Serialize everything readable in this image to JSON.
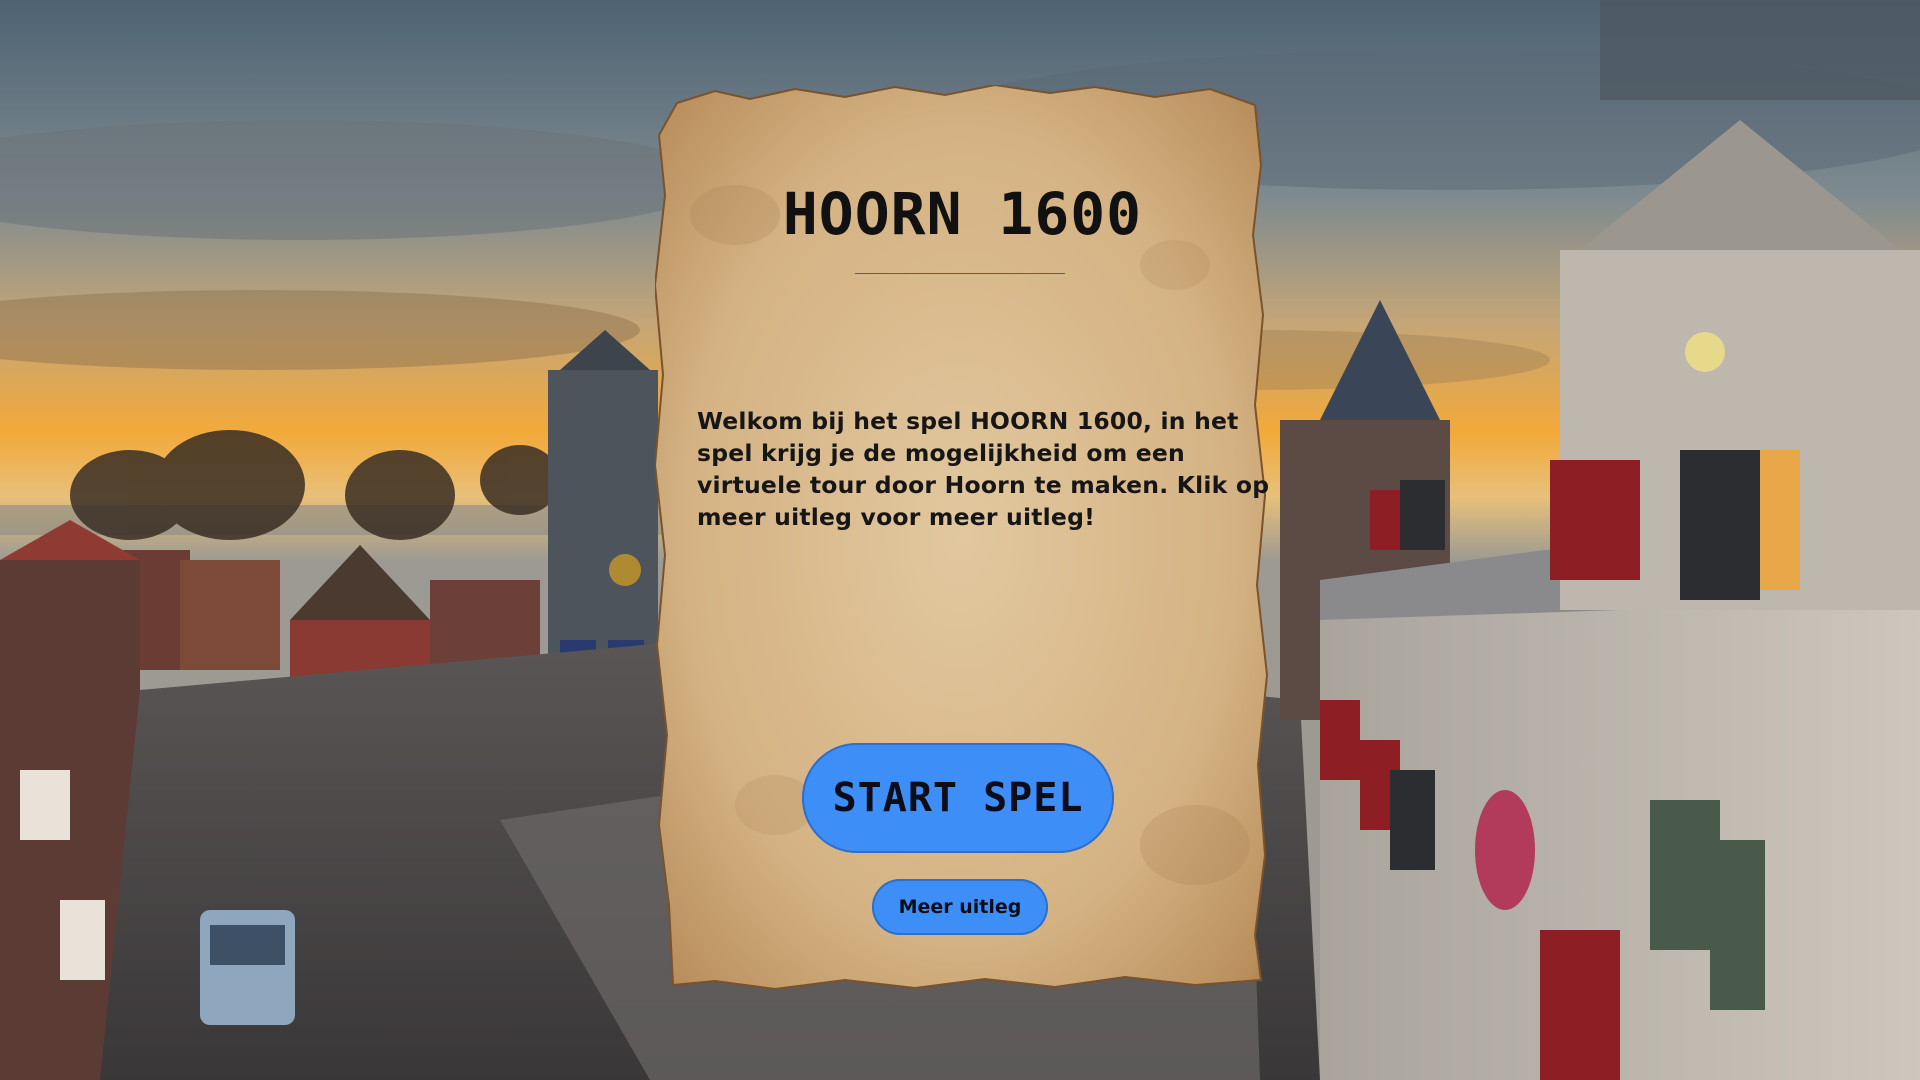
{
  "game": {
    "title": "HOORN 1600",
    "intro_text": "Welkom bij het spel HOORN 1600, in het spel krijg je de mogelijkheid om een virtuele tour door Hoorn te maken. Klik op meer uitleg voor meer uitleg!",
    "start_button_label": "START SPEL",
    "info_button_label": "Meer uitleg"
  },
  "colors": {
    "button": "#3e8ef7",
    "parchment": "#d9b98a",
    "text": "#161616"
  }
}
